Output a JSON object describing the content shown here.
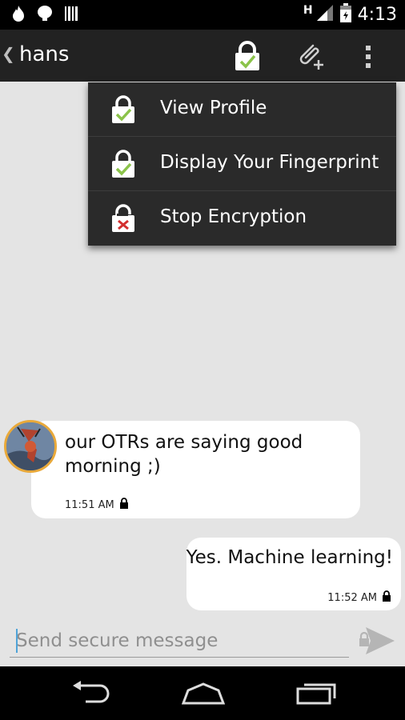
{
  "status_bar": {
    "network_letter": "H",
    "time": "4:13",
    "left_icons": [
      "fire-icon",
      "notification-icon",
      "barcode-icon"
    ],
    "right_icons": [
      "signal-icon",
      "battery-icon"
    ]
  },
  "action_bar": {
    "title": "hans",
    "icons": [
      "back-chevron-icon",
      "lock-verified-icon",
      "attach-icon",
      "overflow-menu-icon"
    ]
  },
  "menu": {
    "items": [
      {
        "label": "View Profile",
        "icon": "lock-verified-icon"
      },
      {
        "label": "Display Your Fingerprint",
        "icon": "lock-verified-icon"
      },
      {
        "label": "Stop Encryption",
        "icon": "unlock-cancel-icon"
      }
    ]
  },
  "messages": [
    {
      "direction": "incoming",
      "text": "our OTRs are saying good morning ;)",
      "time": "11:51 AM",
      "icon": "lock-icon"
    },
    {
      "direction": "outgoing",
      "text": "Yes. Machine learning!",
      "time": "11:52 AM",
      "icon": "lock-icon"
    }
  ],
  "composer": {
    "placeholder": "Send secure message",
    "value": "",
    "send_icon": "send-locked-icon"
  },
  "nav_bar": {
    "icons": [
      "back-icon",
      "home-icon",
      "recents-icon"
    ]
  },
  "colors": {
    "action_bar": "#222222",
    "menu_bg": "#2a2a2a",
    "chat_bg": "#e4e4e4",
    "lock_check": "#8bc34a",
    "unlock_x": "#d32f2f",
    "avatar_ring": "#e9a93a"
  }
}
